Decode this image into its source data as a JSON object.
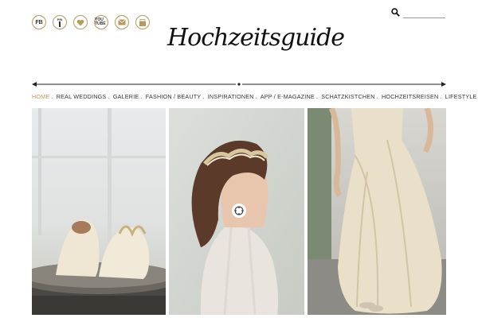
{
  "social": [
    {
      "name": "facebook-icon",
      "label": "FB"
    },
    {
      "name": "pinterest-icon",
      "label": "PIN"
    },
    {
      "name": "heart-icon",
      "label": ""
    },
    {
      "name": "youtube-icon",
      "label": "YOU TUBE"
    },
    {
      "name": "mail-icon",
      "label": ""
    },
    {
      "name": "shop-icon",
      "label": ""
    }
  ],
  "search": {
    "placeholder": ""
  },
  "logo": {
    "text": "Hochzeitsguide"
  },
  "nav": {
    "items": [
      "HOME",
      "REAL WEDDINGS",
      "GALERIE",
      "FASHION / BEAUTY",
      "INSPIRATIONEN",
      "APP / E-MAGAZINE",
      "SCHATZKISTCHEN",
      "HOCHZEITSREISEN",
      "LIFESTYLE"
    ],
    "separator": ".",
    "active_index": 0
  },
  "colors": {
    "accent": "#b59a5b",
    "text": "#333333"
  }
}
